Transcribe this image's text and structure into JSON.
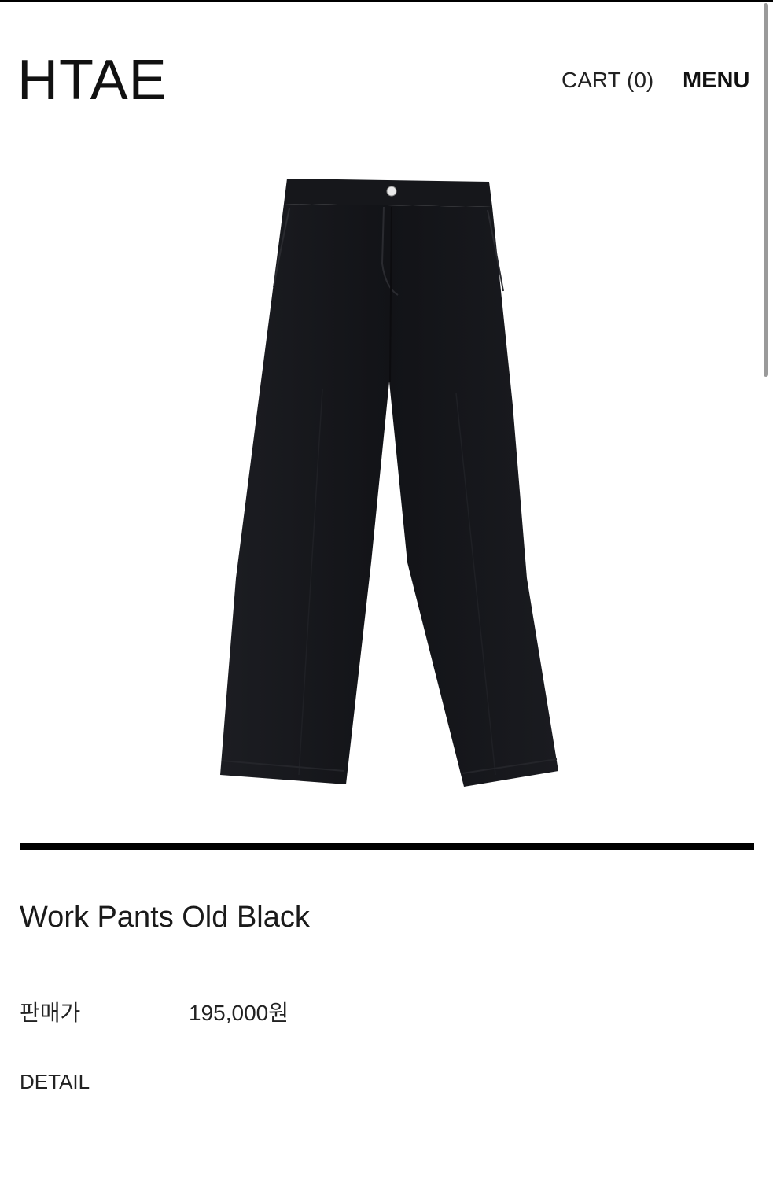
{
  "header": {
    "logo": "HTAE",
    "cart_label": "CART (0)",
    "menu_label": "MENU"
  },
  "product": {
    "image_icon": "black-work-pants-image",
    "name": "Work Pants Old Black",
    "price_label": "판매가",
    "price_value": "195,000원",
    "detail_label": "DETAIL"
  },
  "colors": {
    "background": "#ffffff",
    "text": "#111111",
    "divider": "#000000",
    "pants": "#15161a"
  }
}
